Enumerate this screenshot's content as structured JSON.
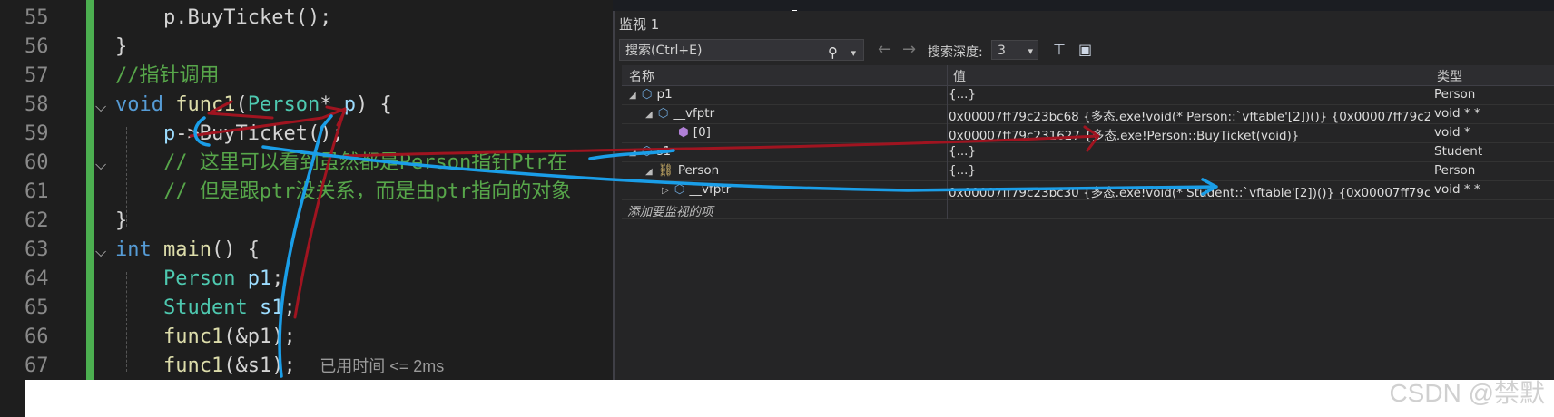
{
  "editor": {
    "lines": [
      {
        "num": "55",
        "text": "p.BuyTicket();"
      },
      {
        "num": "56",
        "text": "}"
      },
      {
        "num": "57",
        "text": "//指针调用"
      },
      {
        "num": "58",
        "kw": "void",
        "fn": "func1",
        "ty": "Person",
        "rest": "* ",
        "pa": "p",
        "end": ") {"
      },
      {
        "num": "59",
        "pa": "p",
        "text": "->BuyTicket();"
      },
      {
        "num": "60",
        "text": "// 这里可以看到虽然都是Person指针Ptr在"
      },
      {
        "num": "61",
        "text": "// 但是跟ptr没关系，而是由ptr指向的对象"
      },
      {
        "num": "62",
        "text": "}"
      },
      {
        "num": "63",
        "kw": "int",
        "fn": "main",
        "end": "() {"
      },
      {
        "num": "64",
        "ty": "Person",
        "pa": "p1",
        "end": ";"
      },
      {
        "num": "65",
        "ty": "Student",
        "pa": "s1",
        "end": ";"
      },
      {
        "num": "66",
        "fn": "func1",
        "text": "(&p1);"
      },
      {
        "num": "67",
        "fn": "func1",
        "text": "(&s1);",
        "hint": "已用时间 <= 2ms"
      }
    ]
  },
  "watch": {
    "title": "监视 1",
    "search_placeholder": "搜索(Ctrl+E)",
    "depth_label": "搜索深度:",
    "depth_value": "3",
    "columns": {
      "name": "名称",
      "value": "值",
      "type": "类型"
    },
    "rows": [
      {
        "name": "p1",
        "value": "{...}",
        "type": "Person"
      },
      {
        "name": "__vfptr",
        "value": "0x00007ff79c23bc68 {多态.exe!void(* Person::`vftable'[2])()} {0x00007ff79c2316...",
        "type": "void * *"
      },
      {
        "name": "[0]",
        "value": "0x00007ff79c231627 {多态.exe!Person::BuyTicket(void)}",
        "type": "void *"
      },
      {
        "name": "s1",
        "value": "{...}",
        "type": "Student"
      },
      {
        "name": "Person",
        "value": "{...}",
        "type": "Person"
      },
      {
        "name": "__vfptr",
        "value": "0x00007ff79c23bc30 {多态.exe!void(* Student::`vftable'[2])()} {0x00007ff79c231...",
        "type": "void * *"
      }
    ],
    "add_item": "添加要监视的项"
  },
  "watermark": "CSDN @禁默",
  "colors": {
    "editor_bg": "#1e1e1e",
    "panel_bg": "#252526",
    "annotation_red": "#a01420",
    "annotation_blue": "#1a9ee8"
  }
}
